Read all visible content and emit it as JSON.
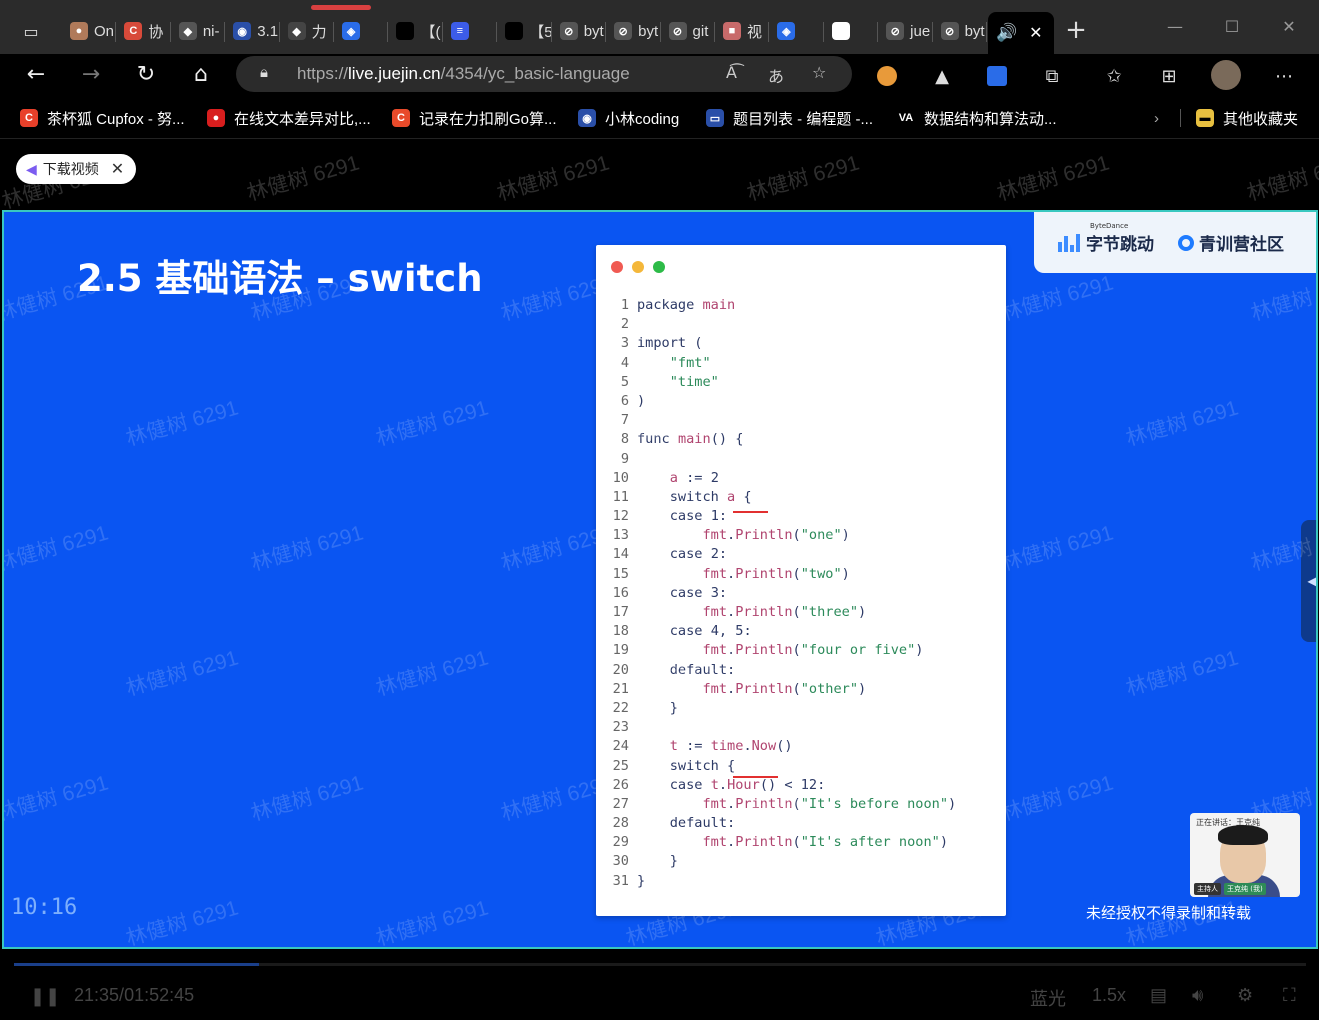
{
  "browser": {
    "tabs": [
      {
        "label": "On",
        "icon_color": "#b07a5a",
        "icon_glyph": "●"
      },
      {
        "label": "协",
        "icon_color": "#d84a3a",
        "icon_glyph": "C"
      },
      {
        "label": "ni-",
        "icon_color": "#555",
        "icon_glyph": "◆"
      },
      {
        "label": "3.1",
        "icon_color": "#2a4fa8",
        "icon_glyph": "◉"
      },
      {
        "label": "力",
        "icon_color": "#444",
        "icon_glyph": "◆"
      },
      {
        "label": "",
        "icon_color": "#2a6ce8",
        "icon_glyph": "◈"
      },
      {
        "label": "【(",
        "icon_color": "#000",
        "icon_glyph": ""
      },
      {
        "label": "",
        "icon_color": "#3c5ce8",
        "icon_glyph": "≡"
      },
      {
        "label": "【5",
        "icon_color": "#000",
        "icon_glyph": ""
      },
      {
        "label": "byt",
        "icon_color": "#555",
        "icon_glyph": "⊘"
      },
      {
        "label": "byt",
        "icon_color": "#555",
        "icon_glyph": "⊘"
      },
      {
        "label": "git",
        "icon_color": "#555",
        "icon_glyph": "⊘"
      },
      {
        "label": "视",
        "icon_color": "#c86a6a",
        "icon_glyph": "■"
      },
      {
        "label": "",
        "icon_color": "#2a6ce8",
        "icon_glyph": "◈"
      },
      {
        "label": "",
        "icon_color": "#fff",
        "icon_glyph": "▭"
      },
      {
        "label": "jue",
        "icon_color": "#555",
        "icon_glyph": "⊘"
      },
      {
        "label": "byt",
        "icon_color": "#555",
        "icon_glyph": "⊘"
      }
    ],
    "active_tab": {
      "icon_glyph": "🔊",
      "close_glyph": "✕"
    },
    "newtab_glyph": "+",
    "url_prefix": "https://",
    "url_host": "live.juejin.cn",
    "url_path": "/4354/yc_basic-language",
    "bookmarks": [
      {
        "label": "茶杯狐 Cupfox - 努...",
        "icon_color": "#e8402a",
        "icon_glyph": "C"
      },
      {
        "label": "在线文本差异对比,...",
        "icon_color": "#d81e1e",
        "icon_glyph": "●"
      },
      {
        "label": "记录在力扣刷Go算...",
        "icon_color": "#e84a2a",
        "icon_glyph": "C"
      },
      {
        "label": "小林coding",
        "icon_color": "#2a4fa8",
        "icon_glyph": "◉"
      },
      {
        "label": "题目列表 - 编程题 -...",
        "icon_color": "#2a4fa8",
        "icon_glyph": "▭"
      },
      {
        "label": "数据结构和算法动...",
        "icon_color": "#000",
        "icon_glyph": "VA"
      }
    ],
    "other_bookmarks": "其他收藏夹"
  },
  "page": {
    "download_chip": "下载视频",
    "watermark_text": "林健树 6291"
  },
  "slide": {
    "title": "2.5 基础语法 – switch",
    "brand_name": "字节跳动",
    "brand_small": "ByteDance",
    "community": "青训营社区",
    "code_lines": [
      {
        "n": "1",
        "html": "package main"
      },
      {
        "n": "2",
        "html": ""
      },
      {
        "n": "3",
        "html": "import ("
      },
      {
        "n": "4",
        "html": "    \"fmt\""
      },
      {
        "n": "5",
        "html": "    \"time\""
      },
      {
        "n": "6",
        "html": ")"
      },
      {
        "n": "7",
        "html": ""
      },
      {
        "n": "8",
        "html": "func main() {"
      },
      {
        "n": "9",
        "html": ""
      },
      {
        "n": "10",
        "html": "    a := 2"
      },
      {
        "n": "11",
        "html": "    switch a {"
      },
      {
        "n": "12",
        "html": "    case 1:"
      },
      {
        "n": "13",
        "html": "        fmt.Println(\"one\")"
      },
      {
        "n": "14",
        "html": "    case 2:"
      },
      {
        "n": "15",
        "html": "        fmt.Println(\"two\")"
      },
      {
        "n": "16",
        "html": "    case 3:"
      },
      {
        "n": "17",
        "html": "        fmt.Println(\"three\")"
      },
      {
        "n": "18",
        "html": "    case 4, 5:"
      },
      {
        "n": "19",
        "html": "        fmt.Println(\"four or five\")"
      },
      {
        "n": "20",
        "html": "    default:"
      },
      {
        "n": "21",
        "html": "        fmt.Println(\"other\")"
      },
      {
        "n": "22",
        "html": "    }"
      },
      {
        "n": "23",
        "html": ""
      },
      {
        "n": "24",
        "html": "    t := time.Now()"
      },
      {
        "n": "25",
        "html": "    switch {"
      },
      {
        "n": "26",
        "html": "    case t.Hour() < 12:"
      },
      {
        "n": "27",
        "html": "        fmt.Println(\"It's before noon\")"
      },
      {
        "n": "28",
        "html": "    default:"
      },
      {
        "n": "29",
        "html": "        fmt.Println(\"It's after noon\")"
      },
      {
        "n": "30",
        "html": "    }"
      },
      {
        "n": "31",
        "html": "}"
      }
    ],
    "timer": "10:16",
    "notice": "未经授权不得录制和转载",
    "speaker_label": "正在讲话：王克纯",
    "speaker_host_tag": "主持人",
    "speaker_name": "王克纯 (我)"
  },
  "player": {
    "current_time": "21:35",
    "total_time": "01:52:45",
    "progress": 0.19,
    "quality": "蓝光",
    "speed": "1.5x"
  }
}
